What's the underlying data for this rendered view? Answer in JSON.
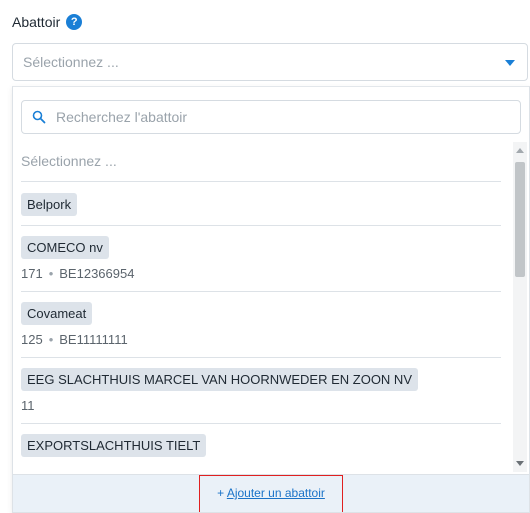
{
  "field": {
    "label": "Abattoir",
    "help_icon": "question-icon",
    "help_glyph": "?",
    "placeholder": "Sélectionnez ..."
  },
  "dropdown": {
    "search_placeholder": "Recherchez l'abattoir",
    "empty_option": "Sélectionnez ...",
    "options": [
      {
        "name": "Belpork"
      },
      {
        "name": "COMECO nv",
        "number": "171",
        "code": "BE12366954"
      },
      {
        "name": "Covameat",
        "number": "125",
        "code": "BE11111111"
      },
      {
        "name": "EEG SLACHTHUIS MARCEL VAN HOORNWEDER EN ZOON NV",
        "number": "11"
      },
      {
        "name": "EXPORTSLACHTHUIS TIELT"
      }
    ],
    "meta_separator": "•",
    "add_prefix": "+",
    "add_label": "Ajouter un abattoir"
  },
  "colors": {
    "accent": "#1a7fd6",
    "tag_background": "#dde3ea",
    "footer_background": "#eaf1f8",
    "highlight_border": "#e02020"
  }
}
